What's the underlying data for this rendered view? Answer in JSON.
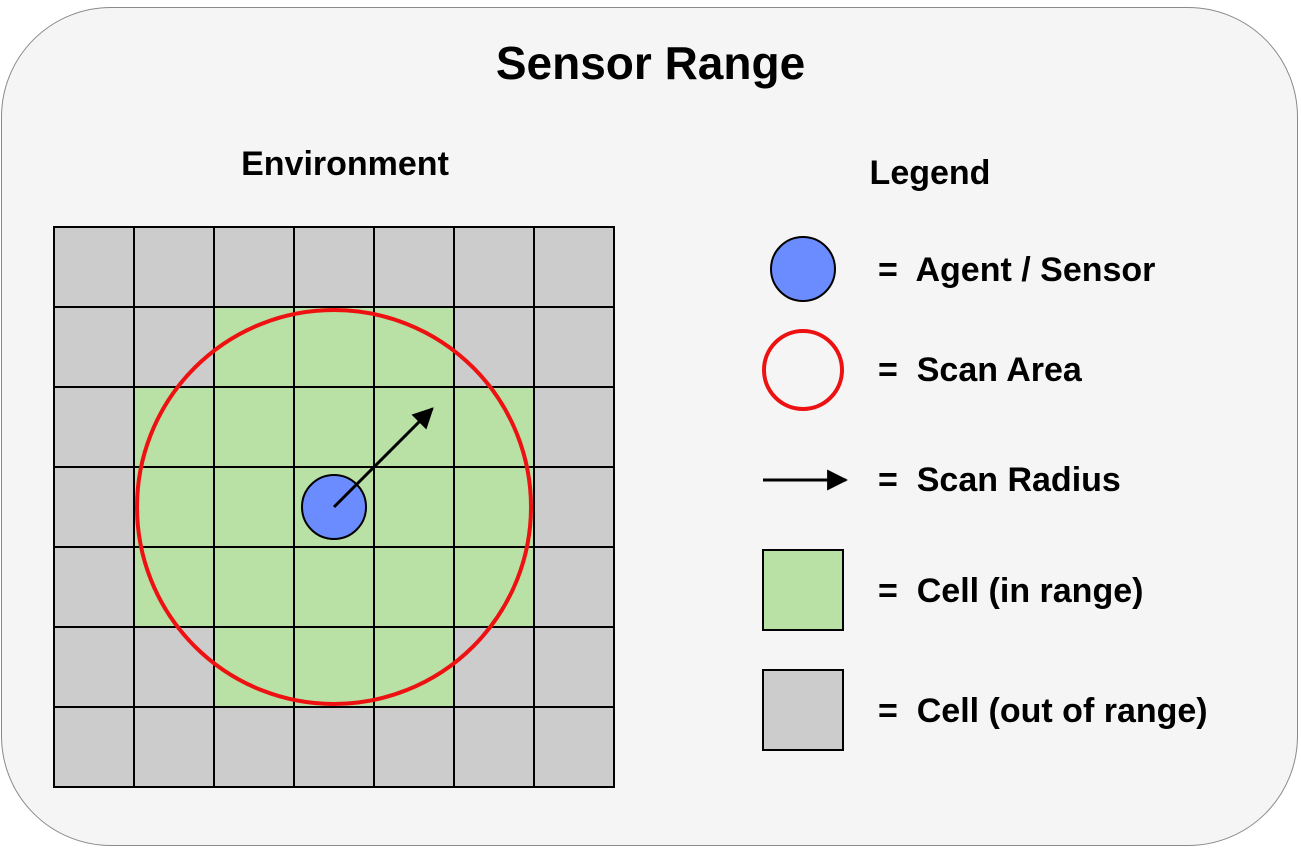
{
  "title": "Sensor Range",
  "environment": {
    "label": "Environment",
    "grid_rows": 7,
    "grid_cols": 7,
    "in_range_cells": [
      [
        1,
        2
      ],
      [
        1,
        3
      ],
      [
        1,
        4
      ],
      [
        2,
        1
      ],
      [
        2,
        2
      ],
      [
        2,
        3
      ],
      [
        2,
        4
      ],
      [
        2,
        5
      ],
      [
        3,
        1
      ],
      [
        3,
        2
      ],
      [
        3,
        3
      ],
      [
        3,
        4
      ],
      [
        3,
        5
      ],
      [
        4,
        1
      ],
      [
        4,
        2
      ],
      [
        4,
        3
      ],
      [
        4,
        4
      ],
      [
        4,
        5
      ],
      [
        5,
        2
      ],
      [
        5,
        3
      ],
      [
        5,
        4
      ]
    ],
    "agent_cell": [
      3,
      3
    ]
  },
  "legend": {
    "title": "Legend",
    "items": [
      {
        "symbol": "agent-circle",
        "label": "=  Agent / Sensor"
      },
      {
        "symbol": "scan-ring",
        "label": "=  Scan Area"
      },
      {
        "symbol": "arrow",
        "label": "=  Scan Radius"
      },
      {
        "symbol": "green-cell",
        "label": "=  Cell (in range)"
      },
      {
        "symbol": "gray-cell",
        "label": "=  Cell (out of range)"
      }
    ]
  },
  "colors": {
    "agent": "#6b8cff",
    "scan_ring": "#ee1111",
    "in_range": "#b9e0a5",
    "out_of_range": "#cccccc",
    "grid_line": "#000000",
    "panel_bg": "#f5f5f5"
  }
}
